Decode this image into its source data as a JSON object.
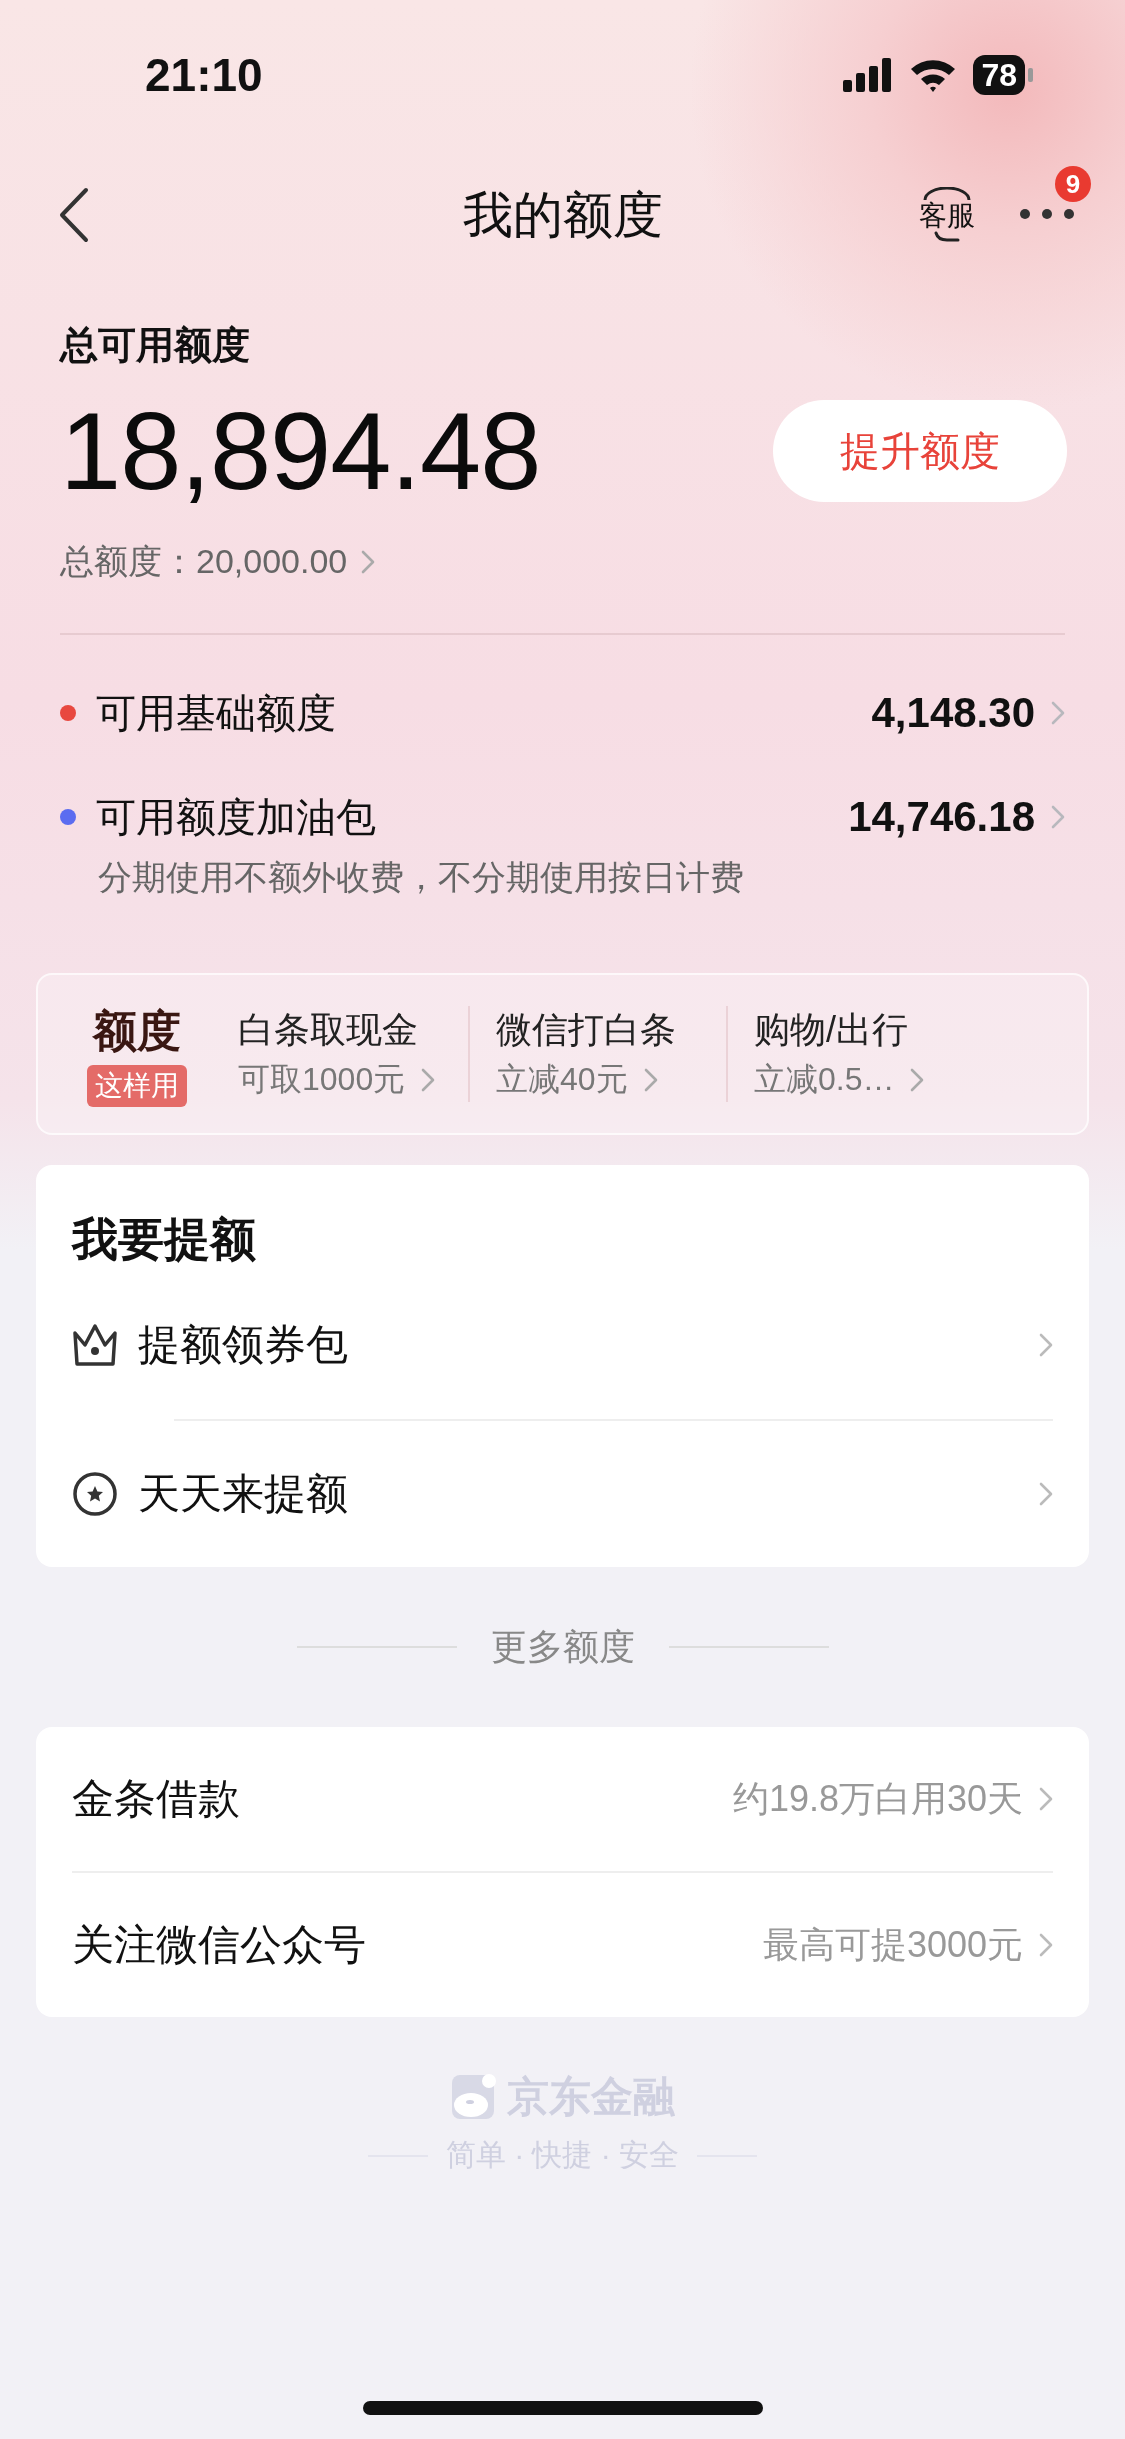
{
  "status_bar": {
    "time": "21:10",
    "battery": "78"
  },
  "nav": {
    "title": "我的额度",
    "service_label": "客服",
    "badge": "9"
  },
  "summary": {
    "label": "总可用额度",
    "amount": "18,894.48",
    "button": "提升额度",
    "total": "总额度：20,000.00"
  },
  "breakdown": [
    {
      "label": "可用基础额度",
      "value": "4,148.30",
      "color": "#e8483f"
    },
    {
      "label": "可用额度加油包",
      "value": "14,746.18",
      "color": "#5b6cf0"
    }
  ],
  "breakdown_note": "分期使用不额外收费，不分期使用按日计费",
  "promo": {
    "title": "额度",
    "tag": "这样用",
    "items": [
      {
        "title": "白条取现金",
        "subtitle": "可取1000元"
      },
      {
        "title": "微信打白条",
        "subtitle": "立减40元"
      },
      {
        "title": "购物/出行",
        "subtitle": "立减0.5…"
      }
    ]
  },
  "raise_section": {
    "title": "我要提额",
    "items": [
      {
        "label": "提额领券包",
        "kind": "crown"
      },
      {
        "label": "天天来提额",
        "kind": "star"
      }
    ]
  },
  "more_heading": "更多额度",
  "more_items": [
    {
      "label": "金条借款",
      "detail": "约19.8万白用30天"
    },
    {
      "label": "关注微信公众号",
      "detail": "最高可提3000元"
    }
  ],
  "footer": {
    "brand": "京东金融",
    "slogan": "简单 · 快捷 · 安全"
  }
}
